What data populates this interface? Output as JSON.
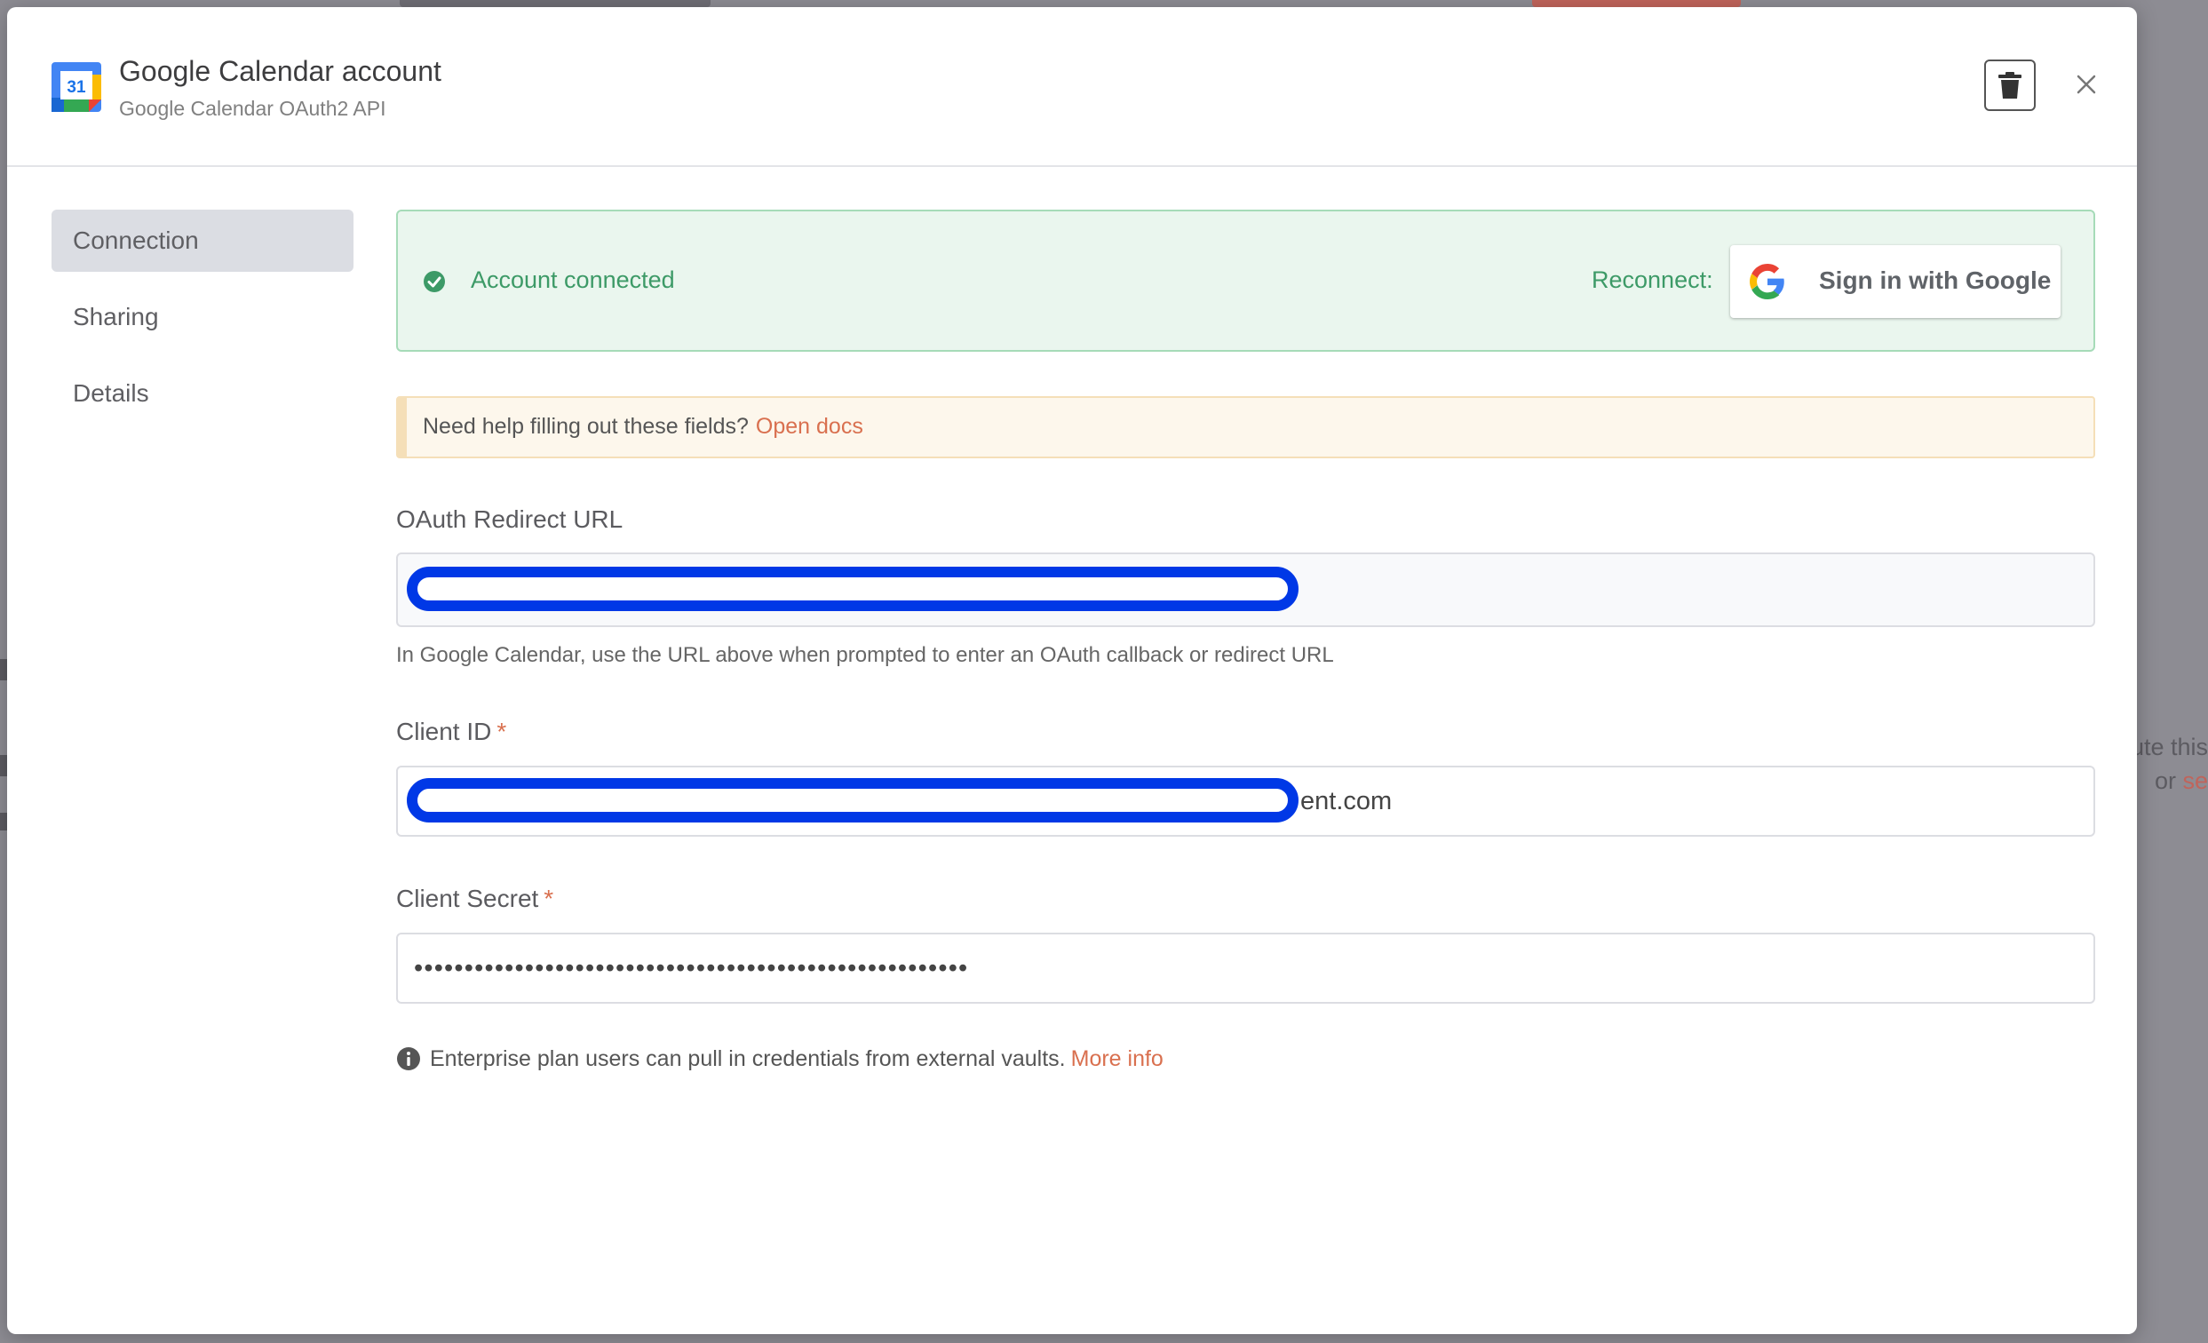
{
  "modal": {
    "title": "Google Calendar account",
    "subtitle": "Google Calendar OAuth2 API",
    "app_icon_text": "31",
    "delete_icon": "trash-icon",
    "close_icon": "close-icon"
  },
  "sidebar": {
    "items": [
      {
        "label": "Connection",
        "active": true
      },
      {
        "label": "Sharing",
        "active": false
      },
      {
        "label": "Details",
        "active": false
      }
    ]
  },
  "connection": {
    "status_text": "Account connected",
    "reconnect_label": "Reconnect:",
    "google_button_label": "Sign in with Google"
  },
  "help": {
    "text": "Need help filling out these fields?",
    "link": "Open docs"
  },
  "fields": {
    "redirect_url": {
      "label": "OAuth Redirect URL",
      "hint": "In Google Calendar, use the URL above when prompted to enter an OAuth callback or redirect URL"
    },
    "client_id": {
      "label": "Client ID",
      "required_mark": "*",
      "visible_value": "ent.com"
    },
    "client_secret": {
      "label": "Client Secret",
      "required_mark": "*",
      "value": "•••••••••••••••••••••••••••••••••••••••••••••••••••••••"
    }
  },
  "footer_info": {
    "text": "Enterprise plan users can pull in credentials from external vaults.",
    "link": "More info"
  },
  "background": {
    "partial_text_1": "ute this",
    "partial_text_2": "or",
    "partial_link": "se"
  },
  "colors": {
    "success": "#3d9a67",
    "accent": "#d9704f",
    "redaction": "#0038e6"
  }
}
